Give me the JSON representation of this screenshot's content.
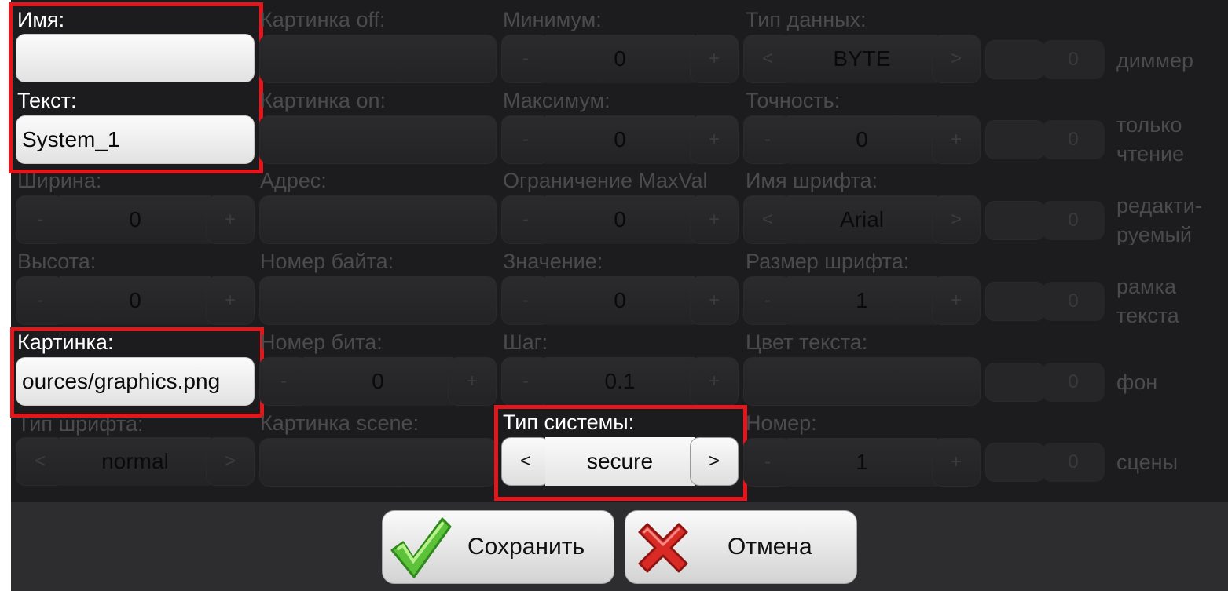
{
  "form": {
    "name": {
      "label": "Имя:",
      "value": ""
    },
    "text": {
      "label": "Текст:",
      "value": "System_1"
    },
    "width": {
      "label": "Ширина:",
      "value": "0"
    },
    "height": {
      "label": "Высота:",
      "value": "0"
    },
    "image": {
      "label": "Картинка:",
      "value": "ources/graphics.png"
    },
    "font_type": {
      "label": "Тип шрифта:",
      "value": "normal"
    },
    "image_off": {
      "label": "Картинка off:",
      "value": ""
    },
    "image_on": {
      "label": "Картинка on:",
      "value": ""
    },
    "address": {
      "label": "Адрес:",
      "value": ""
    },
    "byte_number": {
      "label": "Номер байта:",
      "value": ""
    },
    "bit_number": {
      "label": "Номер бита:",
      "value": "0"
    },
    "image_scene": {
      "label": "Картинка scene:",
      "value": ""
    },
    "minimum": {
      "label": "Минимум:",
      "value": "0"
    },
    "maximum": {
      "label": "Максимум:",
      "value": "0"
    },
    "maxval_limit": {
      "label": "Ограничение MaxVal",
      "value": "0"
    },
    "value": {
      "label": "Значение:",
      "value": "0"
    },
    "step": {
      "label": "Шаг:",
      "value": "0.1"
    },
    "system_type": {
      "label": "Тип системы:",
      "value": "secure"
    },
    "data_type": {
      "label": "Тип данных:",
      "value": "BYTE"
    },
    "precision": {
      "label": "Точность:",
      "value": "0"
    },
    "font_name": {
      "label": "Имя шрифта:",
      "value": "Arial"
    },
    "font_size": {
      "label": "Размер шрифта:",
      "value": "1"
    },
    "text_color": {
      "label": "Цвет текста:",
      "value": ""
    },
    "number": {
      "label": "Номер:",
      "value": "1"
    }
  },
  "stepper_glyphs": {
    "minus": "-",
    "plus": "+",
    "prev": "<",
    "next": ">"
  },
  "flags": [
    {
      "lines": [
        "диммер"
      ],
      "value": "0"
    },
    {
      "lines": [
        "только",
        "чтение"
      ],
      "value": "0"
    },
    {
      "lines": [
        "редакти-",
        "руемый"
      ],
      "value": "0"
    },
    {
      "lines": [
        "рамка",
        "текста"
      ],
      "value": "0"
    },
    {
      "lines": [
        "фон"
      ],
      "value": "0"
    },
    {
      "lines": [
        "сцены"
      ],
      "value": "0"
    }
  ],
  "actions": {
    "save_label": "Сохранить",
    "cancel_label": "Отмена"
  },
  "colors": {
    "highlight": "#e3161b",
    "panel_bg": "#1c1c1e",
    "save_icon": "#5cc23a",
    "cancel_icon": "#d92a26"
  }
}
